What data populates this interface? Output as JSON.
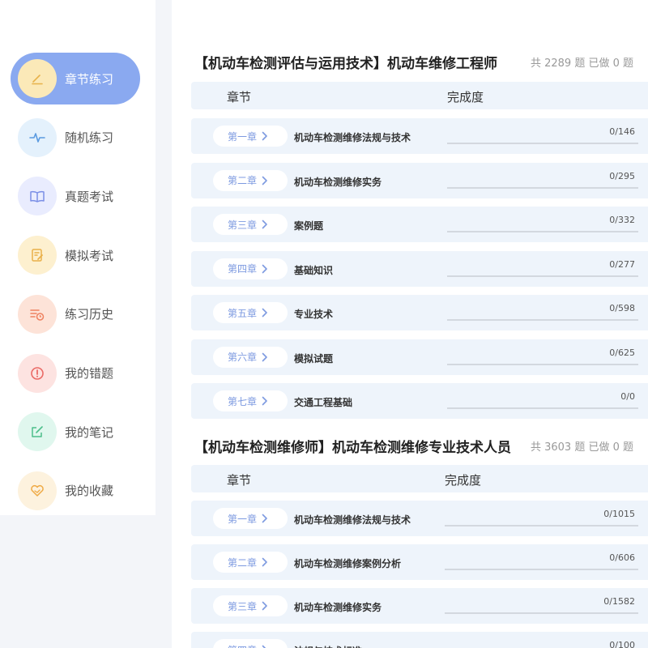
{
  "sidebar": {
    "items": [
      {
        "label": "章节练习",
        "icon": "pencil-icon",
        "bg": "#fbe9b8",
        "color": "#e7b24b",
        "active": true
      },
      {
        "label": "随机练习",
        "icon": "pulse-icon",
        "bg": "#e4f1fc",
        "color": "#5b9be0",
        "active": false
      },
      {
        "label": "真题考试",
        "icon": "book-icon",
        "bg": "#e9ecfe",
        "color": "#7b8fe6",
        "active": false
      },
      {
        "label": "模拟考试",
        "icon": "edit-doc-icon",
        "bg": "#fdf0cf",
        "color": "#eab04a",
        "active": false
      },
      {
        "label": "练习历史",
        "icon": "history-list-icon",
        "bg": "#fde3d8",
        "color": "#ee8160",
        "active": false
      },
      {
        "label": "我的错题",
        "icon": "alert-circle-icon",
        "bg": "#fde3e1",
        "color": "#ea6a66",
        "active": false
      },
      {
        "label": "我的笔记",
        "icon": "note-edit-icon",
        "bg": "#e0f7ee",
        "color": "#4cbe8a",
        "active": false
      },
      {
        "label": "我的收藏",
        "icon": "heart-icon",
        "bg": "#fdf2de",
        "color": "#efaa45",
        "active": false
      }
    ]
  },
  "colors": {
    "accent": "#8aa9f0",
    "chip_text": "#7d9ae0",
    "row_bg": "#eef4fb",
    "bar_track": "#d3d8df"
  },
  "sections": [
    {
      "title": "【机动车检测评估与运用技术】机动车维修工程师",
      "stats": "共 2289 题 已做 0 题",
      "header_chapter": "章节",
      "header_progress": "完成度",
      "rows": [
        {
          "chapter": "第一章",
          "title": "机动车检测维修法规与技术",
          "count": "0/146",
          "done": 0,
          "total": 146
        },
        {
          "chapter": "第二章",
          "title": "机动车检测维修实务",
          "count": "0/295",
          "done": 0,
          "total": 295
        },
        {
          "chapter": "第三章",
          "title": "案例题",
          "count": "0/332",
          "done": 0,
          "total": 332
        },
        {
          "chapter": "第四章",
          "title": "基础知识",
          "count": "0/277",
          "done": 0,
          "total": 277
        },
        {
          "chapter": "第五章",
          "title": "专业技术",
          "count": "0/598",
          "done": 0,
          "total": 598
        },
        {
          "chapter": "第六章",
          "title": "模拟试题",
          "count": "0/625",
          "done": 0,
          "total": 625
        },
        {
          "chapter": "第七章",
          "title": "交通工程基础",
          "count": "0/0",
          "done": 0,
          "total": 0
        }
      ]
    },
    {
      "title": "【机动车检测维修师】机动车检测维修专业技术人员",
      "stats": "共 3603 题 已做 0 题",
      "header_chapter": "章节",
      "header_progress": "完成度",
      "rows": [
        {
          "chapter": "第一章",
          "title": "机动车检测维修法规与技术",
          "count": "0/1015",
          "done": 0,
          "total": 1015
        },
        {
          "chapter": "第二章",
          "title": "机动车检测维修案例分析",
          "count": "0/606",
          "done": 0,
          "total": 606
        },
        {
          "chapter": "第三章",
          "title": "机动车检测维修实务",
          "count": "0/1582",
          "done": 0,
          "total": 1582
        },
        {
          "chapter": "第四章",
          "title": "法规与技术标准",
          "count": "0/100",
          "done": 0,
          "total": 100
        }
      ]
    }
  ]
}
